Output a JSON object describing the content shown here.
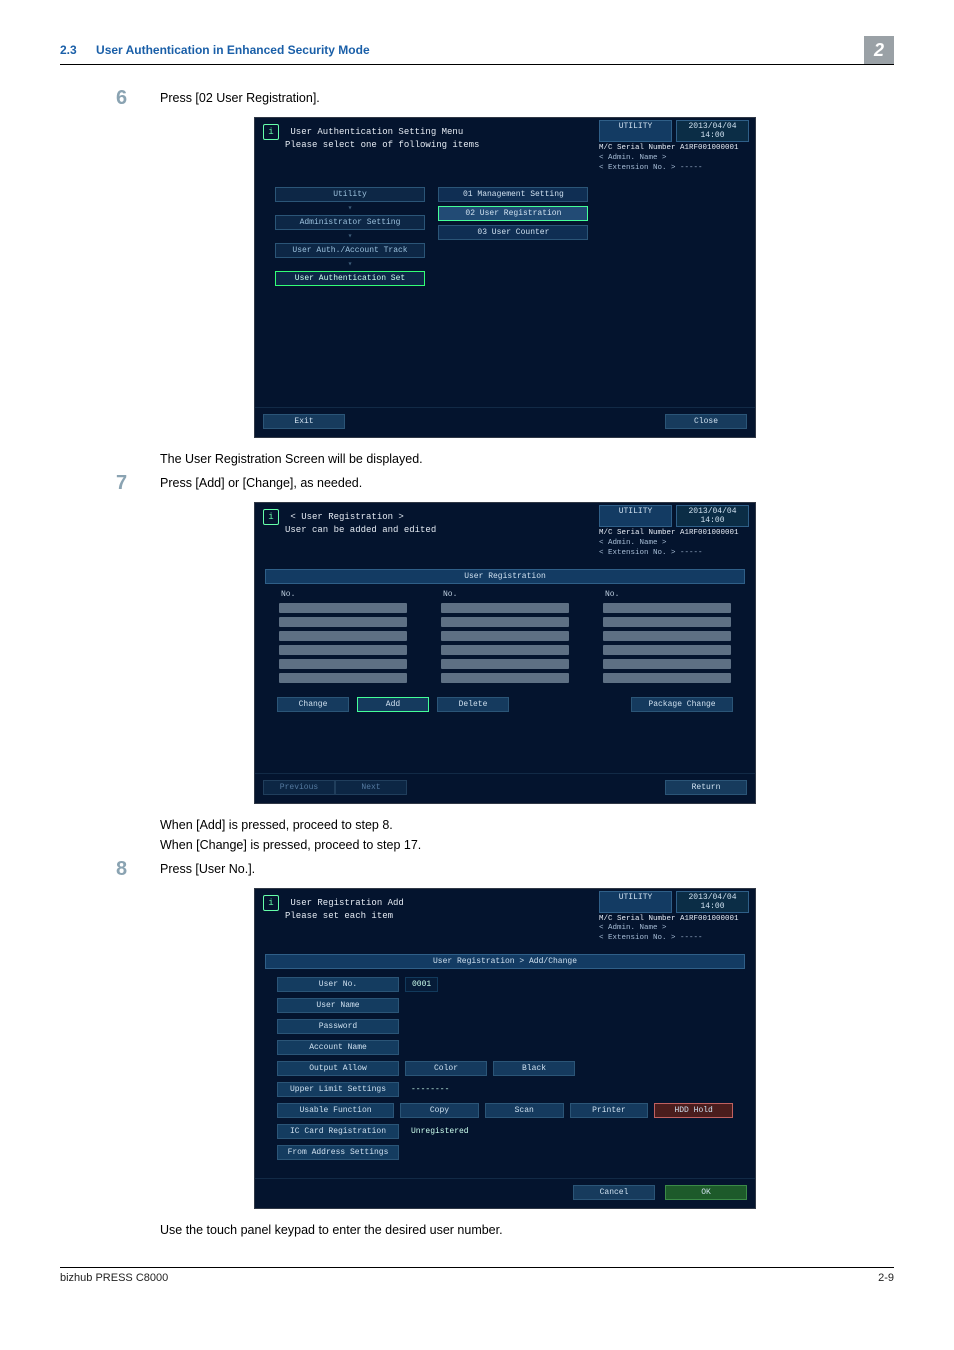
{
  "header": {
    "section_num": "2.3",
    "section_title": "User Authentication in Enhanced Security Mode",
    "chapter_badge": "2"
  },
  "step6": {
    "num": "6",
    "text": "Press [02 User Registration].",
    "after": "The User Registration Screen will be displayed."
  },
  "step7": {
    "num": "7",
    "text": "Press [Add] or [Change], as needed.",
    "after1": "When [Add] is pressed, proceed to step 8.",
    "after2": "When [Change] is pressed, proceed to step 17."
  },
  "step8": {
    "num": "8",
    "text": "Press [User No.].",
    "after": "Use the touch panel keypad to enter the desired user number."
  },
  "panel_common": {
    "util_label": "UTILITY",
    "timestamp": "2013/04/04 14:00",
    "serial_line": "M/C Serial Number  A1RF001000001",
    "admin_line": "< Admin. Name >",
    "ext_line": "< Extension No. >  -----"
  },
  "panel1": {
    "title_l1": "User Authentication Setting Menu",
    "title_l2": "Please select one of following items",
    "crumbs": [
      "Utility",
      "Administrator Setting",
      "User Auth./Account Track",
      "User Authentication Set"
    ],
    "menu": [
      "01 Management Setting",
      "02 User Registration",
      "03 User Counter"
    ],
    "exit": "Exit",
    "close": "Close"
  },
  "panel2": {
    "title_l1": "< User Registration >",
    "title_l2": "User can be added and edited",
    "strip": "User Registration",
    "col_h": "No.",
    "btn_change": "Change",
    "btn_add": "Add",
    "btn_delete": "Delete",
    "btn_package": "Package Change",
    "nav_prev": "Previous",
    "nav_next": "Next",
    "return": "Return"
  },
  "panel3": {
    "title_l1": "User Registration Add",
    "title_l2": "Please set each item",
    "strip": "User Registration > Add/Change",
    "labels": {
      "user_no": "User No.",
      "user_name": "User Name",
      "password": "Password",
      "account_name": "Account Name",
      "output_allow": "Output Allow",
      "upper_limit": "Upper Limit Settings",
      "auth_fn": "Usable Function",
      "ic_card": "IC Card Registration",
      "from_addr": "From Address Settings"
    },
    "user_no_val": "0001",
    "upper_limit_val": "--------",
    "ic_card_val": "Unregistered",
    "pills": {
      "color": "Color",
      "black": "Black",
      "copy": "Copy",
      "scan": "Scan",
      "printer": "Printer",
      "hdd_hold": "HDD Hold"
    },
    "cancel": "Cancel",
    "ok": "OK"
  },
  "footer": {
    "left": "bizhub PRESS C8000",
    "right": "2-9"
  }
}
